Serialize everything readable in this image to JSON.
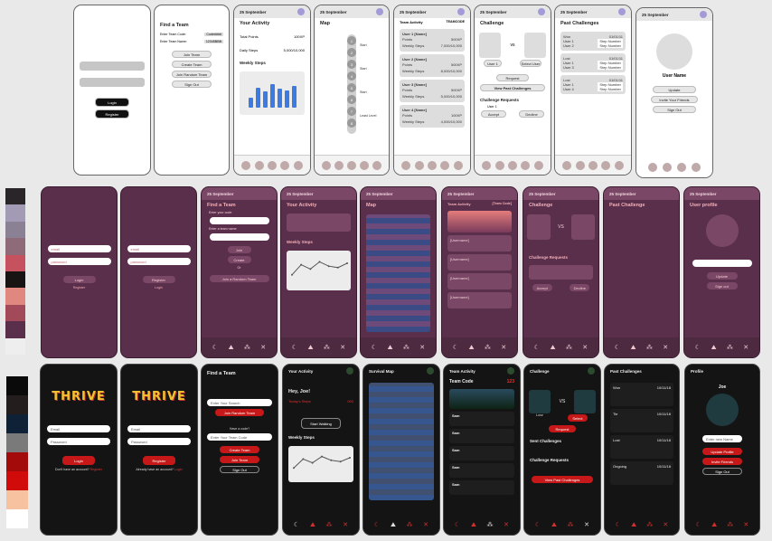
{
  "palette_a": [
    "#2a2528",
    "#a39ab5",
    "#8a8194",
    "#8f6b7a",
    "#c7525f",
    "#181414",
    "#e0887f",
    "#a34a5a",
    "#5a2f4c",
    "#eeeeee"
  ],
  "palette_b": [
    "#0a0a0a",
    "#231d1d",
    "#0f2136",
    "#7a7a7a",
    "#a30a0a",
    "#d10a0a",
    "#f7c29f",
    "#ffffff"
  ],
  "common": {
    "date": "25 September",
    "login": "Login",
    "register": "Register",
    "email": "email",
    "password": "password",
    "nav": [
      "Activity",
      "Map",
      "Team",
      "Chall",
      "Profile"
    ]
  },
  "wf": {
    "s1": {
      "login": "Login",
      "register": "Register"
    },
    "s2": {
      "title": "Find a Team",
      "code_label": "Enter Team Code:",
      "code_val": "Code####",
      "name_label": "Enter Team Name:",
      "name_val": "12345BBB",
      "join": "Join Team",
      "create": "Create Team",
      "random": "Join Random Team",
      "signout": "Sign Out"
    },
    "s3": {
      "title": "Your Activity",
      "total_label": "Total Points",
      "total_val": "100XP",
      "steps_label": "Daily Steps",
      "steps_val": "5,000/10,000",
      "weekly": "Weekly Steps"
    },
    "s4": {
      "title": "Map",
      "nodes": [
        "1",
        "2",
        "3",
        "4",
        "5",
        "6",
        "7",
        "8"
      ],
      "labels": [
        "Start",
        "Start",
        "Start",
        "Least Level"
      ]
    },
    "s5": {
      "title": "Team Activity",
      "code": "TEAMCODE",
      "users": [
        {
          "name": "User 1 [Name]",
          "points": "500XP",
          "steps": "7,000/10,000"
        },
        {
          "name": "User 2 [Name]",
          "points": "500XP",
          "steps": "8,000/10,000"
        },
        {
          "name": "User 3 [Name]",
          "points": "500XP",
          "steps": "5,000/10,000"
        },
        {
          "name": "User 4 [Name]",
          "points": "100XP",
          "steps": "4,000/10,000"
        }
      ],
      "points_label": "Points",
      "steps_label": "Weekly Steps"
    },
    "s6": {
      "title": "Challenge",
      "vs": "vs",
      "user1": "User 1",
      "user2": "Select User",
      "request": "Request",
      "view_past": "View Past Challenges",
      "req_title": "Challenge Requests",
      "req_user": "User 1",
      "accept": "Accept",
      "decline": "Decline"
    },
    "s7": {
      "title": "Past Challenges",
      "rows": [
        {
          "status": "Won",
          "date": "01/01/11",
          "l1": "User 1",
          "v1": "Step Number",
          "l2": "User 2",
          "v2": "Step Number"
        },
        {
          "status": "Lost",
          "date": "01/01/11",
          "l1": "User 1",
          "v1": "Step Number",
          "l2": "User 3",
          "v2": "Step Number"
        },
        {
          "status": "Lost",
          "date": "01/01/11",
          "l1": "User 1",
          "v1": "Step Number",
          "l2": "User 4",
          "v2": "Step Number"
        }
      ]
    },
    "s8": {
      "username": "User Name",
      "update": "Update",
      "invite": "Invite Your Friends",
      "signout": "Sign Out"
    }
  },
  "pu": {
    "s2": {
      "login": "Login",
      "link": "Login"
    },
    "s3": {
      "title": "Find a Team",
      "code_label": "Enter your code",
      "name_label": "Enter a team name",
      "join": "Join",
      "create": "Create",
      "or": "Or",
      "random": "Join a Random Team"
    },
    "s4": {
      "title": "Your Activity",
      "weekly": "Weekly Steps"
    },
    "s5": {
      "title": "Map"
    },
    "s6": {
      "title": "Team Activity",
      "code": "[Team Code]",
      "user": "[Username]"
    },
    "s7": {
      "title": "Challenge",
      "vs": "VS",
      "req": "Challenge Requests",
      "accept": "Accept",
      "decline": "Decline"
    },
    "s8": {
      "title": "Past Challenge"
    },
    "s9": {
      "title": "User profile",
      "update": "Update",
      "signout": "Sign out"
    }
  },
  "dk": {
    "s1": {
      "logo": "THRIVE",
      "email": "Email",
      "password": "Password",
      "login": "Login",
      "no_acc": "Don't have an account?",
      "reg_link": "Register"
    },
    "s2": {
      "logo": "THRIVE",
      "email": "Email",
      "password": "Password",
      "register": "Register",
      "have": "Already have an account?",
      "login_link": "Login"
    },
    "s3": {
      "title": "Find a Team",
      "search": "Enter Your Search",
      "random": "Join Random Team",
      "have_code": "Have a code?",
      "code_ph": "Enter Your Team Code",
      "create": "Create Team",
      "join": "Join Team",
      "signout": "Sign Out"
    },
    "s4": {
      "title": "Your Activity",
      "greet": "Hey, Joe!",
      "steps_label": "Today's Steps",
      "steps_val": "000",
      "start": "Start Walking",
      "weekly": "Weekly Steps"
    },
    "s5": {
      "title": "Survival Map"
    },
    "s6": {
      "title": "Team Activity",
      "code_label": "Team Code",
      "code": "123",
      "rows": [
        "Sam",
        "Sam",
        "Sam",
        "Sam",
        "Sam"
      ]
    },
    "s7": {
      "title": "Challenge",
      "vs": "VS",
      "lose": "Lose",
      "win": "Select",
      "request": "Request",
      "sent": "Sent Challenges",
      "reqs": "Challenge Requests",
      "view": "View Past Challenges"
    },
    "s8": {
      "title": "Past Challenges",
      "rows": [
        {
          "status": "Won",
          "date": "10/11/18"
        },
        {
          "status": "Tie",
          "date": "10/11/18"
        },
        {
          "status": "Lost",
          "date": "10/11/18"
        },
        {
          "status": "Ongoing",
          "date": "10/11/18"
        }
      ]
    },
    "s9": {
      "title": "Profile",
      "name": "Joe",
      "email_ph": "Enter new Name",
      "update": "Update Profile",
      "invite": "Invite Friends",
      "signout": "Sign Out"
    }
  },
  "chart_weekly": {
    "days": [
      "M",
      "T",
      "W",
      "T",
      "F",
      "S",
      "S"
    ],
    "values": [
      0.35,
      0.7,
      0.55,
      0.8,
      0.65,
      0.6,
      0.75
    ]
  }
}
